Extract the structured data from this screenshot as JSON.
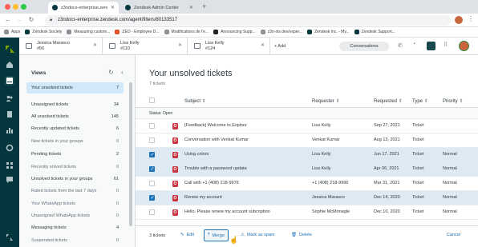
{
  "browser": {
    "tabs": [
      {
        "title": "z3ndocs-enterprise.zendesk.co...",
        "active": true
      },
      {
        "title": "Zendesk Admin Center",
        "active": false
      }
    ],
    "url": "z3ndocs-enterprise.zendesk.com/agent/filters/80133517",
    "bookmarks": [
      "Apps",
      "Zendesk Society",
      "Measuring custom...",
      "ZEO - Employee D...",
      "Modifications de l'e...",
      "Announcing Supp...",
      "z3n-iris dev/exper...",
      "Zendesk Inc. - My...",
      "Zendesk Support..."
    ]
  },
  "ticket_tabs": [
    {
      "name": "Jessica Marasco",
      "id": "#56"
    },
    {
      "name": "Lisa Kelly",
      "id": "#110"
    },
    {
      "name": "Lisa Kelly",
      "id": "#124"
    }
  ],
  "toolbar": {
    "add_label": "+ Add",
    "conversations_label": "Conversations"
  },
  "views_panel": {
    "title": "Views",
    "items": [
      {
        "label": "Your unsolved tickets",
        "count": "7",
        "selected": true
      },
      {
        "label": "Unassigned tickets",
        "count": "34"
      },
      {
        "label": "All unsolved tickets",
        "count": "145"
      },
      {
        "label": "Recently updated tickets",
        "count": "6"
      },
      {
        "label": "New tickets in your groups",
        "count": "0"
      },
      {
        "label": "Pending tickets",
        "count": "2"
      },
      {
        "label": "Recently solved tickets",
        "count": "0"
      },
      {
        "label": "Unsolved tickets in your groups",
        "count": "61"
      },
      {
        "label": "Rated tickets from the last 7 days",
        "count": "0"
      },
      {
        "label": "Your WhatsApp tickets",
        "count": "0"
      },
      {
        "label": "Unassigned WhatsApp tickets",
        "count": "0"
      },
      {
        "label": "Messaging tickets",
        "count": "4"
      },
      {
        "label": "Suspended tickets",
        "count": "0"
      }
    ]
  },
  "main": {
    "title": "Your unsolved tickets",
    "subtitle": "7 tickets",
    "columns": {
      "subject": "Subject",
      "requester": "Requester",
      "requested": "Requested",
      "type": "Type",
      "priority": "Priority"
    },
    "group_label": "Status: Open",
    "rows": [
      {
        "subject": "[Feedback] Welcome to Explore",
        "requester": "Lisa Kelly",
        "requested": "Sep 27, 2021",
        "type": "Ticket",
        "priority": "",
        "selected": false
      },
      {
        "subject": "Conversation with Venkat Kumar",
        "requester": "Venkat Kumar",
        "requested": "Aug 13, 2021",
        "type": "Ticket",
        "priority": "",
        "selected": false
      },
      {
        "subject": "Using colors",
        "requester": "Lisa Kelly",
        "requested": "Jun 17, 2021",
        "type": "Ticket",
        "priority": "Normal",
        "selected": true
      },
      {
        "subject": "Trouble with a password update",
        "requester": "Lisa Kelly",
        "requested": "Apr 06, 2021",
        "type": "Ticket",
        "priority": "Normal",
        "selected": true
      },
      {
        "subject": "Call with +1 (408) 218-9976",
        "requester": "+1 (408) 218-9996",
        "requested": "Mar 31, 2021",
        "type": "Ticket",
        "priority": "Normal",
        "selected": false
      },
      {
        "subject": "Renew my account",
        "requester": "Jessica Marasco",
        "requested": "Dec 14, 2020",
        "type": "Ticket",
        "priority": "Normal",
        "selected": true
      },
      {
        "subject": "Hello. Please renew my account subcription",
        "requester": "Sophie McMonagle",
        "requested": "Dec 10, 2020",
        "type": "Ticket",
        "priority": "Normal",
        "selected": false
      }
    ],
    "status_letter": "O"
  },
  "footer": {
    "count_label": "3 tickets",
    "edit_label": "Edit",
    "merge_label": "Merge",
    "spam_label": "Mark as spam",
    "delete_label": "Delete",
    "cancel_label": "Cancel"
  },
  "colors": {
    "nav_bg": "#03363d",
    "accent": "#1f73b7",
    "status_open": "#cc3340",
    "selected_row": "#dde9f3"
  }
}
